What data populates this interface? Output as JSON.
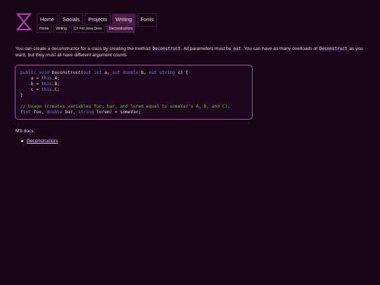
{
  "site": {
    "logo_icon": "hourglass-logo-icon",
    "accent_color": "#c03cc8"
  },
  "nav": {
    "items": [
      {
        "label": "Home",
        "active": false
      },
      {
        "label": "Socials",
        "active": false
      },
      {
        "label": "Projects",
        "active": false
      },
      {
        "label": "Writing",
        "active": true
      },
      {
        "label": "Fonts",
        "active": false
      }
    ]
  },
  "breadcrumb": {
    "items": [
      {
        "label": "Home"
      },
      {
        "label": "Writing"
      },
      {
        "label": "C# For Java Devs"
      },
      {
        "label": "Deconstructors",
        "active": true
      }
    ]
  },
  "intro": {
    "part1": "You can create a deconstructor for a class by creating the method ",
    "code1": "Deconstruct",
    "part2": ". All parameters must be ",
    "code2": "out",
    "part3": ". You can have as many overloads of ",
    "code3": "Deconstruct",
    "part4": " as you want, but they must all have different argument counts"
  },
  "code": {
    "line1": {
      "kw1": "public",
      "kw2": "void",
      "name": "Deconstruct(",
      "kw3": "out",
      "kw4": "int",
      "a": "a, ",
      "kw5": "out",
      "kw6": "double",
      "b": "b, ",
      "kw7": "out",
      "kw8": "string",
      "c": "c) {"
    },
    "line2": {
      "pre": "    a = ",
      "kw": "this",
      "post": ".A;"
    },
    "line3": {
      "pre": "    b = ",
      "kw": "this",
      "post": ".B;"
    },
    "line4": {
      "pre": "    c = ",
      "kw": "this",
      "post": ".C;"
    },
    "line5": "}",
    "line6": "// Usage (creates variables foo, bar, and lorem equal to someVar's A, B, and C):",
    "line7": {
      "open": "(",
      "kw1": "int",
      "foo": " foo, ",
      "kw2": "double",
      "bar": " bar, ",
      "kw3": "string",
      "rest": " lorem) = someVar;"
    }
  },
  "docs": {
    "label": "MS docs:",
    "links": [
      {
        "label": "Deconstructors"
      }
    ]
  }
}
